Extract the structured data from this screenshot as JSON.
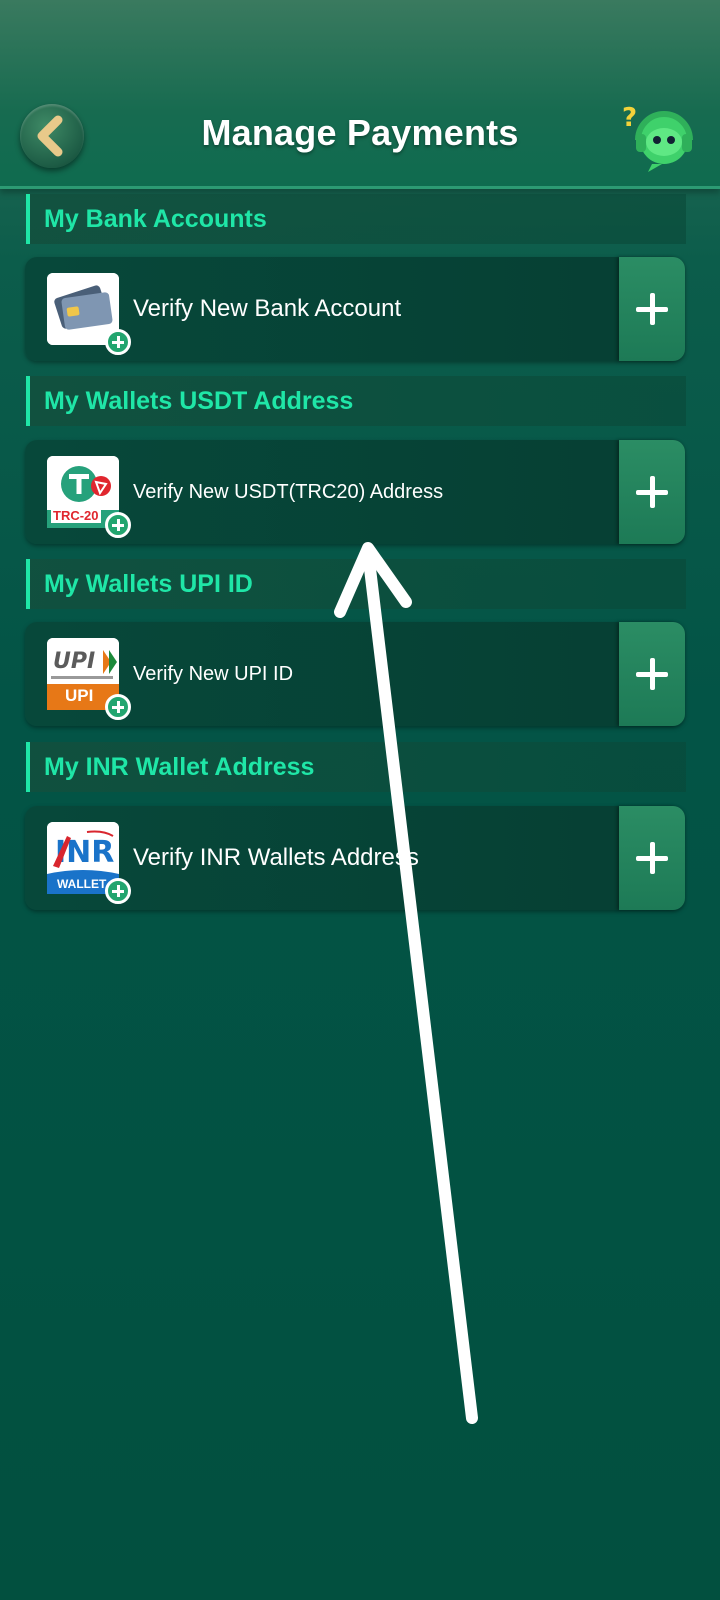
{
  "header": {
    "title": "Manage Payments",
    "back_icon": "chevron-left-icon",
    "support_icon": "customer-support-icon"
  },
  "sections": [
    {
      "title": "My Bank Accounts",
      "item": {
        "label": "Verify New Bank Account",
        "icon": "credit-card-icon"
      }
    },
    {
      "title": "My Wallets USDT Address",
      "item": {
        "label": "Verify New USDT(TRC20) Address",
        "icon": "usdt-trc20-icon",
        "icon_text": "TRC-20"
      }
    },
    {
      "title": "My Wallets UPI ID",
      "item": {
        "label": "Verify New UPI ID",
        "icon": "upi-icon",
        "icon_text": "UPI"
      }
    },
    {
      "title": "My INR Wallet Address",
      "item": {
        "label": "Verify INR Wallets Address",
        "icon": "inr-wallet-icon",
        "icon_text": "WALLET"
      }
    }
  ],
  "colors": {
    "accent": "#1fe6a7",
    "background": "#035446",
    "card": "#07483a",
    "plus_button": "#2b8d64"
  }
}
